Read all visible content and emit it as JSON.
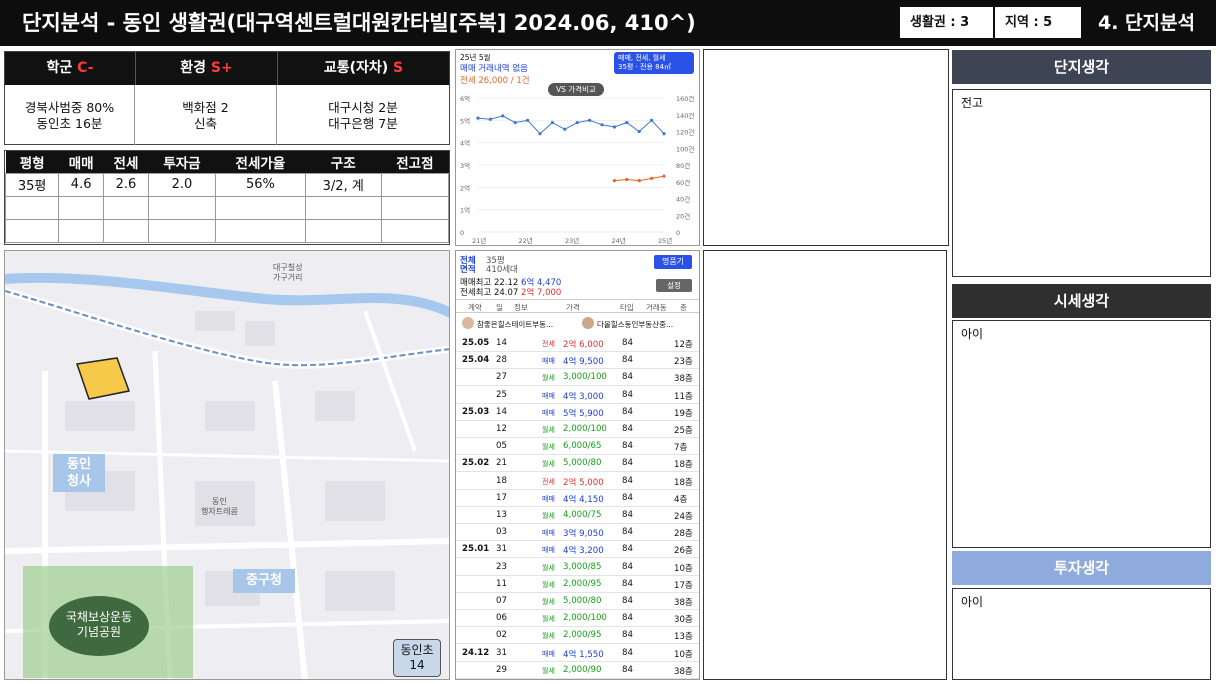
{
  "header": {
    "title": "단지분석 - 동인 생활권(대구역센트럴대원칸타빌[주복] 2024.06, 410^)",
    "zone": "생활권 : 3",
    "region": "지역 : 5",
    "section": "4. 단지분석"
  },
  "scores": [
    {
      "label": "학군",
      "grade": "C-",
      "lines": [
        "경북사범중 80%",
        "동인초 16분"
      ]
    },
    {
      "label": "환경",
      "grade": "S+",
      "lines": [
        "백화점 2",
        "신축"
      ]
    },
    {
      "label": "교통(자차)",
      "grade": "S",
      "lines": [
        "대구시청 2분",
        "대구은행 7분"
      ]
    }
  ],
  "price_table": {
    "headers": [
      "평형",
      "매매",
      "전세",
      "투자금",
      "전세가율",
      "구조",
      "전고점"
    ],
    "rows": [
      [
        "35평",
        "4.6",
        "2.6",
        "2.0",
        "56%",
        "3/2, 계",
        ""
      ],
      [
        "",
        "",
        "",
        "",
        "",
        "",
        ""
      ],
      [
        "",
        "",
        "",
        "",
        "",
        "",
        ""
      ]
    ]
  },
  "chart_panel": {
    "date": "25년 5월",
    "status": "매매 거래내역 없음",
    "jeonse_summary": "전세 26,000 / 1건",
    "filter": "매매, 전세, 월세",
    "filter_sub": "35평 · 전용 84㎡",
    "compare_btn": "VS 가격비교"
  },
  "chart_data": {
    "type": "line",
    "x": [
      "21년",
      "22년",
      "23년",
      "24년",
      "25년"
    ],
    "left_axis_ticks": [
      "0",
      "1억",
      "2억",
      "3억",
      "4억",
      "5억",
      "6억"
    ],
    "right_axis_ticks": [
      "0",
      "20건",
      "40건",
      "60건",
      "80건",
      "100건",
      "120건",
      "140건",
      "160건"
    ],
    "series": [
      {
        "color": "#3f78d6",
        "values": [
          5.1,
          5.05,
          5.2,
          4.9,
          5.0,
          4.4,
          4.9,
          4.6,
          4.9,
          5.0,
          4.8,
          4.7,
          4.9,
          4.5,
          5.0,
          4.4
        ]
      },
      {
        "color": "#e8642c",
        "values": [
          null,
          null,
          null,
          null,
          null,
          null,
          null,
          null,
          null,
          null,
          null,
          2.3,
          2.35,
          2.3,
          2.4,
          2.5
        ]
      }
    ],
    "ylim": [
      0,
      6
    ]
  },
  "listing_panel": {
    "type_label": "전체",
    "type_label2": "면적",
    "pyeong": "35평",
    "households": "410세대",
    "button": "명품기",
    "max_sale_label": "매매최고",
    "max_sale_date": "22.12",
    "max_sale_price": "6억 4,470",
    "max_jeonse_label": "전세최고",
    "max_jeonse_date": "24.07",
    "max_jeonse_price": "2억 7,000",
    "setting": "설정",
    "col_headers": [
      "계약",
      "일",
      "정보",
      "가격",
      "타입",
      "거래동",
      "층"
    ],
    "agent1": "참좋은힐스테이트부동...",
    "agent2": "다올힐스동인부동산중...",
    "rows": [
      {
        "month": "25.05",
        "day": "14",
        "kind": "전세",
        "price": "2억 6,000",
        "type": "84",
        "floor": "12층"
      },
      {
        "month": "25.04",
        "day": "28",
        "kind": "매매",
        "price": "4억 9,500",
        "type": "84",
        "floor": "23층"
      },
      {
        "month": "",
        "day": "27",
        "kind": "월세",
        "price": "3,000/100",
        "type": "84",
        "floor": "38층"
      },
      {
        "month": "",
        "day": "25",
        "kind": "매매",
        "price": "4억 3,000",
        "type": "84",
        "floor": "11층"
      },
      {
        "month": "25.03",
        "day": "14",
        "kind": "매매",
        "price": "5억 5,900",
        "type": "84",
        "floor": "19층"
      },
      {
        "month": "",
        "day": "12",
        "kind": "월세",
        "price": "2,000/100",
        "type": "84",
        "floor": "25층"
      },
      {
        "month": "",
        "day": "05",
        "kind": "월세",
        "price": "6,000/65",
        "type": "84",
        "floor": "7층"
      },
      {
        "month": "25.02",
        "day": "21",
        "kind": "월세",
        "price": "5,000/80",
        "type": "84",
        "floor": "18층"
      },
      {
        "month": "",
        "day": "18",
        "kind": "전세",
        "price": "2억 5,000",
        "type": "84",
        "floor": "18층"
      },
      {
        "month": "",
        "day": "17",
        "kind": "매매",
        "price": "4억 4,150",
        "type": "84",
        "floor": "4층"
      },
      {
        "month": "",
        "day": "13",
        "kind": "월세",
        "price": "4,000/75",
        "type": "84",
        "floor": "24층"
      },
      {
        "month": "",
        "day": "03",
        "kind": "매매",
        "price": "3억 9,050",
        "type": "84",
        "floor": "28층"
      },
      {
        "month": "25.01",
        "day": "31",
        "kind": "매매",
        "price": "4억 3,200",
        "type": "84",
        "floor": "26층"
      },
      {
        "month": "",
        "day": "23",
        "kind": "월세",
        "price": "3,000/85",
        "type": "84",
        "floor": "10층"
      },
      {
        "month": "",
        "day": "11",
        "kind": "월세",
        "price": "2,000/95",
        "type": "84",
        "floor": "17층"
      },
      {
        "month": "",
        "day": "07",
        "kind": "월세",
        "price": "5,000/80",
        "type": "84",
        "floor": "38층"
      },
      {
        "month": "",
        "day": "06",
        "kind": "월세",
        "price": "2,000/100",
        "type": "84",
        "floor": "30층"
      },
      {
        "month": "",
        "day": "02",
        "kind": "월세",
        "price": "2,000/95",
        "type": "84",
        "floor": "13층"
      },
      {
        "month": "24.12",
        "day": "31",
        "kind": "매매",
        "price": "4억 1,550",
        "type": "84",
        "floor": "10층"
      },
      {
        "month": "",
        "day": "29",
        "kind": "월세",
        "price": "2,000/90",
        "type": "84",
        "floor": "38층"
      }
    ]
  },
  "map": {
    "labels": {
      "dongin_office": "동인\n청사",
      "junggu_office": "중구청",
      "park": "국채보상운동\n기념공원",
      "school": "동인초\n14",
      "label_daegu_sungang": "대구칠성\n가구거리",
      "label_dongin_apt": "동인\n행자트레콤"
    }
  },
  "notes": {
    "complex_title": "단지생각",
    "complex_text": "전고",
    "market_title": "시세생각",
    "market_text": "아이",
    "invest_title": "투자생각",
    "invest_text": "아이"
  },
  "colors": {
    "header_bg": "#0d0d0d",
    "complex_hdr": "#3d4454",
    "market_hdr": "#2f2f2f",
    "invest_hdr": "#8faadc",
    "grade_red": "#ff3b3b"
  }
}
